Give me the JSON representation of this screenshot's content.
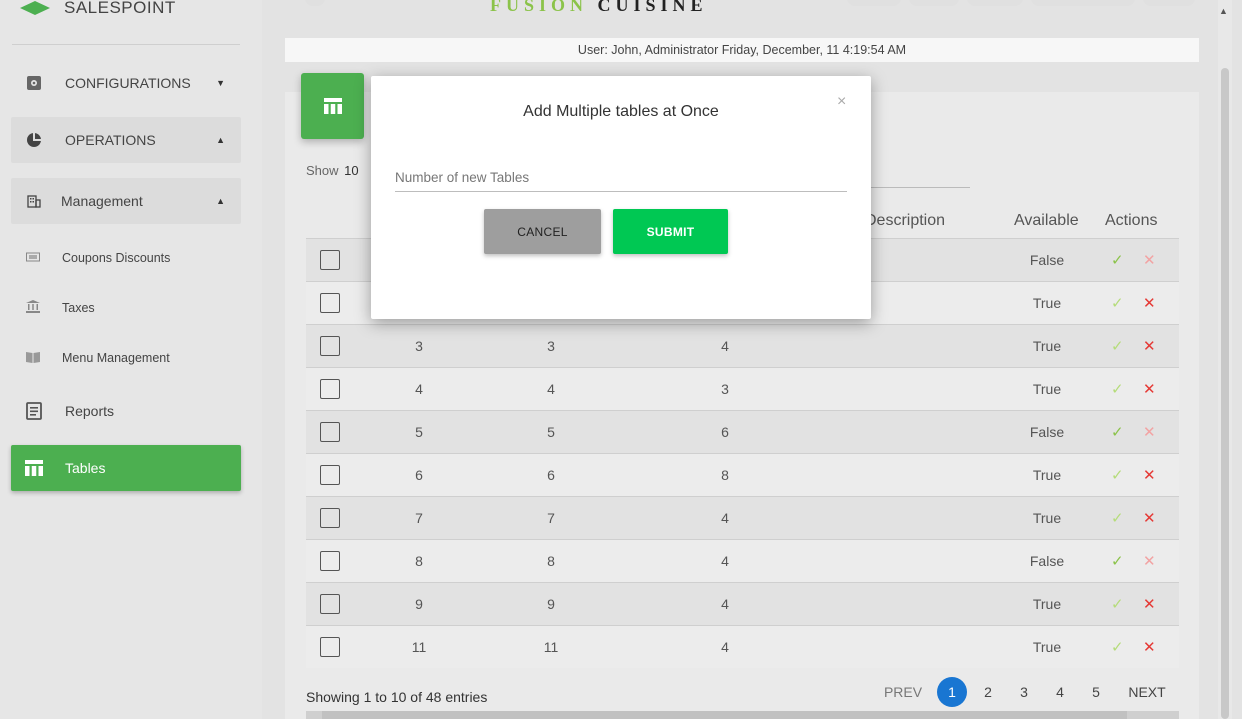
{
  "brand": {
    "name": "SALESPOINT"
  },
  "header": {
    "title_part1": "FUSION",
    "title_part2": "CUISINE",
    "user_status": "User: John, Administrator Friday, December, 11 4:19:54 AM"
  },
  "sidebar": {
    "items": [
      {
        "label": "CONFIGURATIONS",
        "icon": "gear-icon",
        "caret": "down"
      },
      {
        "label": "OPERATIONS",
        "icon": "pie-chart-icon",
        "caret": "up"
      },
      {
        "label": "Management",
        "icon": "building-icon",
        "caret": "up"
      },
      {
        "label": "Coupons Discounts",
        "icon": "coupon-icon"
      },
      {
        "label": "Taxes",
        "icon": "bank-icon"
      },
      {
        "label": "Menu Management",
        "icon": "book-icon"
      },
      {
        "label": "Reports",
        "icon": "report-icon"
      },
      {
        "label": "Tables",
        "icon": "table-icon",
        "active": true
      }
    ]
  },
  "table": {
    "show_label": "Show",
    "show_value": "10",
    "headers": {
      "description": "Description",
      "available": "Available",
      "actions": "Actions"
    },
    "rows": [
      {
        "c1": "",
        "c2": "",
        "c3": "",
        "available": "False"
      },
      {
        "c1": "",
        "c2": "",
        "c3": "",
        "available": "True"
      },
      {
        "c1": "3",
        "c2": "3",
        "c3": "4",
        "available": "True"
      },
      {
        "c1": "4",
        "c2": "4",
        "c3": "3",
        "available": "True"
      },
      {
        "c1": "5",
        "c2": "5",
        "c3": "6",
        "available": "False"
      },
      {
        "c1": "6",
        "c2": "6",
        "c3": "8",
        "available": "True"
      },
      {
        "c1": "7",
        "c2": "7",
        "c3": "4",
        "available": "True"
      },
      {
        "c1": "8",
        "c2": "8",
        "c3": "4",
        "available": "False"
      },
      {
        "c1": "9",
        "c2": "9",
        "c3": "4",
        "available": "True"
      },
      {
        "c1": "11",
        "c2": "11",
        "c3": "4",
        "available": "True"
      }
    ]
  },
  "footer": {
    "info": "Showing 1 to 10 of 48 entries",
    "prev": "PREV",
    "pages": [
      "1",
      "2",
      "3",
      "4",
      "5"
    ],
    "next": "NEXT"
  },
  "modal": {
    "title": "Add Multiple tables at Once",
    "close": "×",
    "input_placeholder": "Number of new Tables",
    "input_value": "",
    "cancel": "CANCEL",
    "submit": "SUBMIT"
  },
  "colors": {
    "accent": "#4caf50",
    "submit": "#00c853",
    "page_active": "#1976d2",
    "check": "#8bc34a",
    "cross": "#e53935"
  }
}
